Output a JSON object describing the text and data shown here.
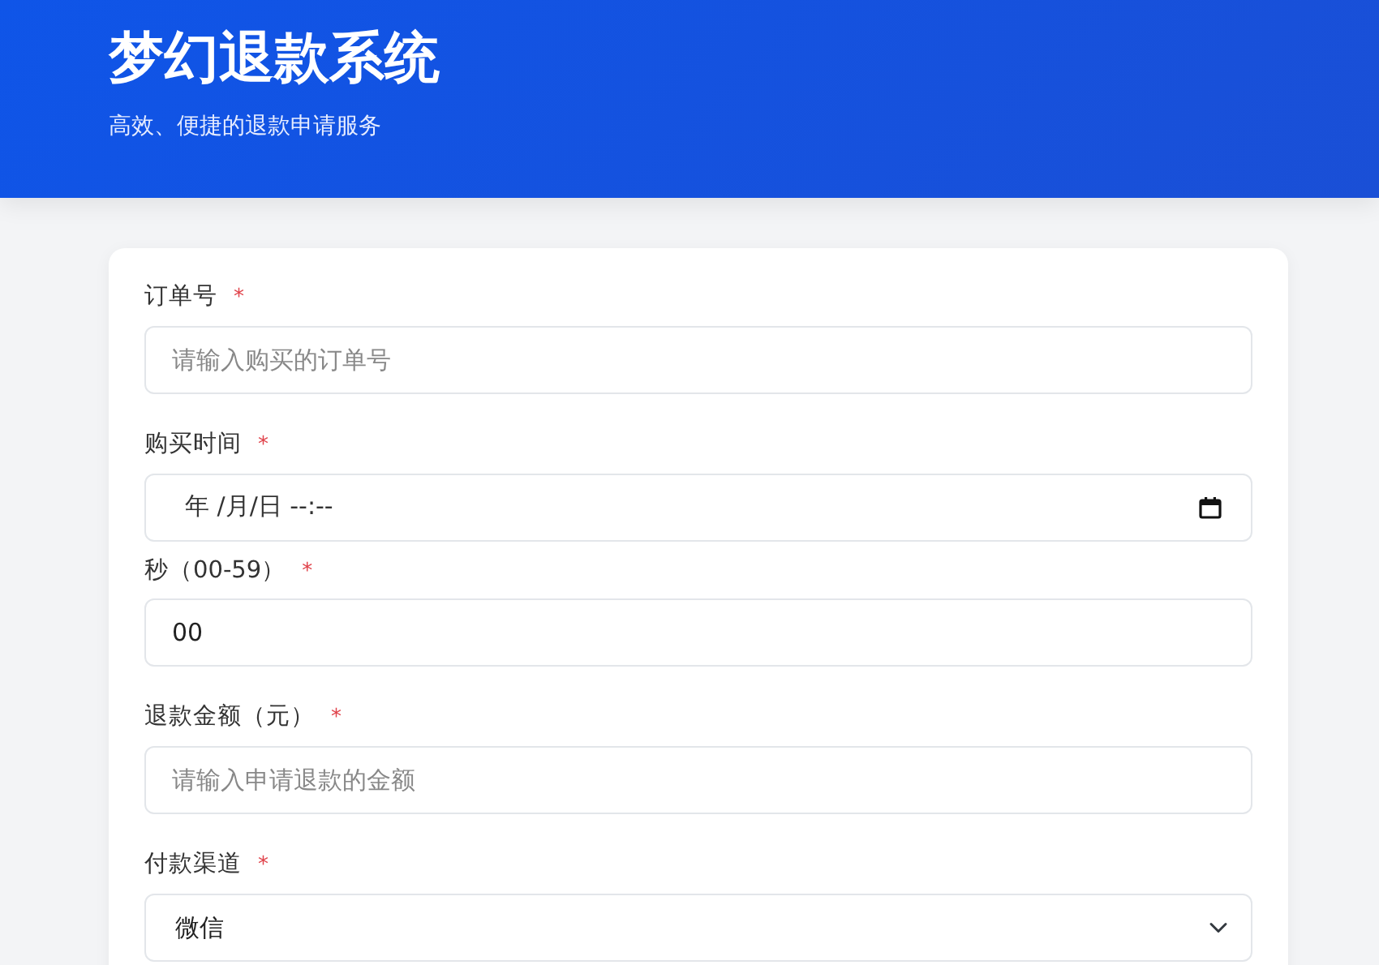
{
  "header": {
    "title": "梦幻退款系统",
    "subtitle": "高效、便捷的退款申请服务"
  },
  "fields": [
    {
      "kind": "text",
      "label": "订单号",
      "required_mark": "*",
      "placeholder": "请输入购买的订单号"
    },
    {
      "kind": "datetime",
      "label": "购买时间",
      "required_mark": "*",
      "display": "年 /月/日 --:--"
    },
    {
      "kind": "text",
      "label": "秒（00-59）",
      "required_mark": "*",
      "value": "00"
    },
    {
      "kind": "text",
      "label": "退款金额（元）",
      "required_mark": "*",
      "placeholder": "请输入申请退款的金额"
    },
    {
      "kind": "select",
      "label": "付款渠道",
      "required_mark": "*",
      "value": "微信"
    }
  ]
}
